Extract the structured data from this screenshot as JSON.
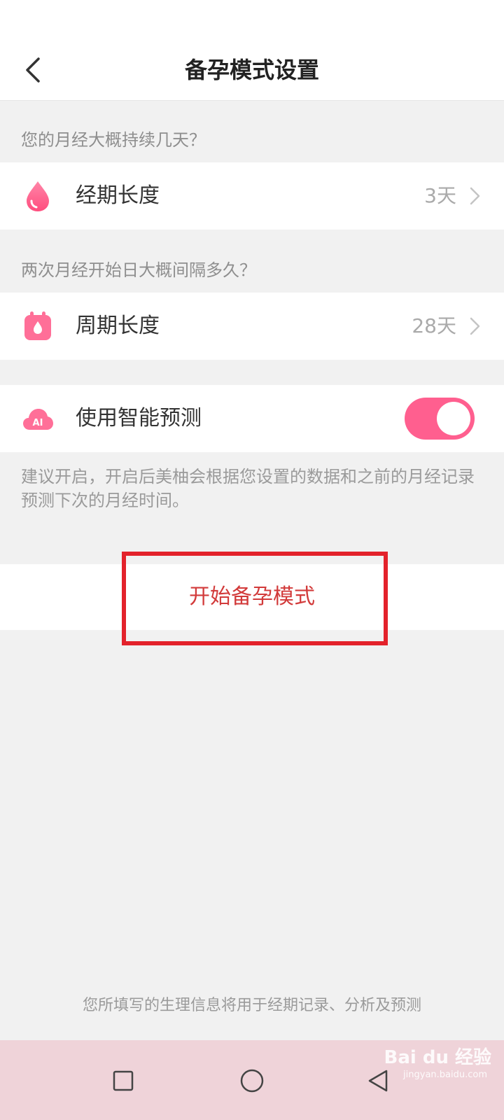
{
  "header": {
    "title": "备孕模式设置"
  },
  "period_section": {
    "question": "您的月经大概持续几天？",
    "label": "经期长度",
    "value": "3天"
  },
  "cycle_section": {
    "question": "两次月经开始日大概间隔多久？",
    "label": "周期长度",
    "value": "28天"
  },
  "prediction": {
    "label": "使用智能预测",
    "icon_text": "AI",
    "enabled": true,
    "note": "建议开启，开启后美柚会根据您设置的数据和之前的月经记录预测下次的月经时间。"
  },
  "start_button": {
    "label": "开始备孕模式"
  },
  "footer": {
    "disclaimer": "您所填写的生理信息将用于经期记录、分析及预测"
  },
  "watermark": {
    "text": "Bai du 经验",
    "sub": "jingyan.baidu.com"
  },
  "colors": {
    "accent": "#ff5f8f",
    "start_text": "#d23a3a",
    "highlight": "#e3222b",
    "navbar": "#efd3d9"
  },
  "icons": {
    "back": "chevron-left-icon",
    "period": "blood-drop-icon",
    "cycle": "calendar-drop-icon",
    "prediction": "ai-cloud-icon"
  }
}
